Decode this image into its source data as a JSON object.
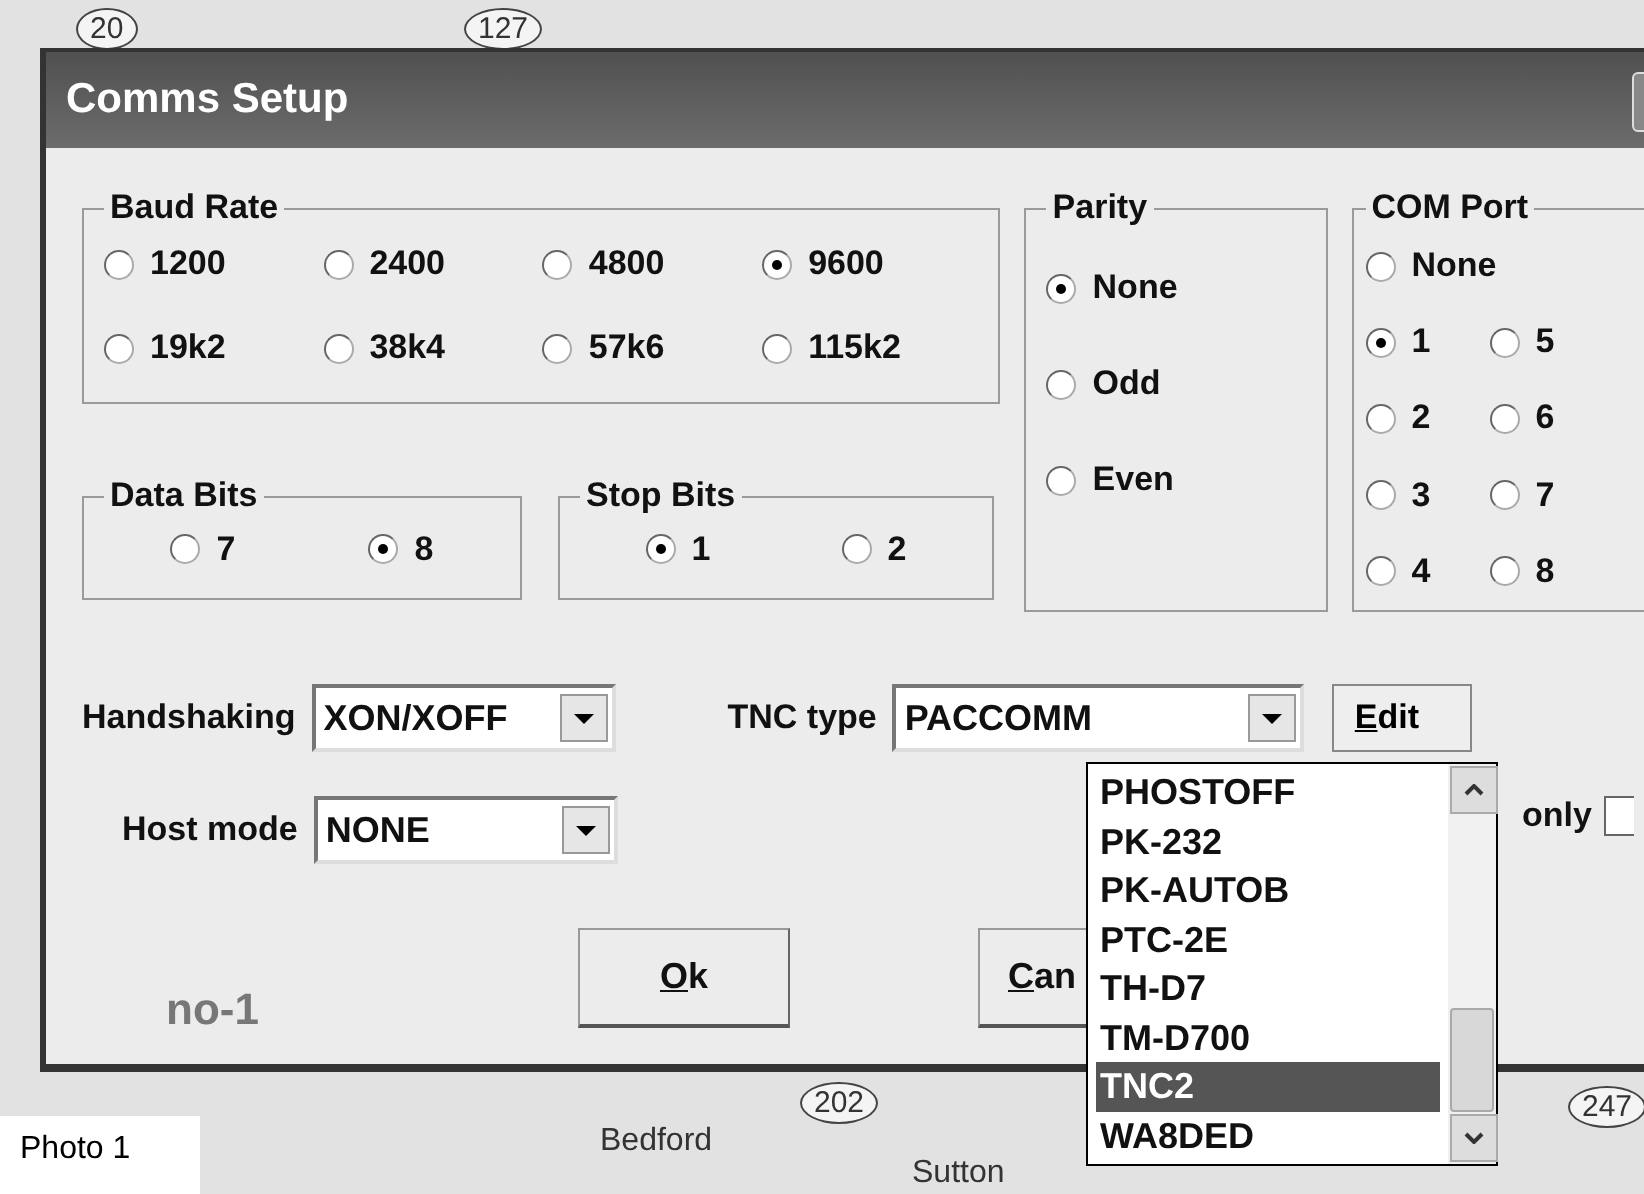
{
  "map": {
    "labels": [
      {
        "text": "20",
        "kind": "route"
      },
      {
        "text": "127",
        "kind": "route"
      },
      {
        "text": "202",
        "kind": "route"
      },
      {
        "text": "247",
        "kind": "route"
      },
      {
        "text": "Bedford",
        "kind": "place"
      },
      {
        "text": "Sutton",
        "kind": "place"
      }
    ]
  },
  "window": {
    "title": "Comms Setup"
  },
  "baud_rate": {
    "label": "Baud Rate",
    "options": [
      {
        "label": "1200",
        "selected": false
      },
      {
        "label": "2400",
        "selected": false
      },
      {
        "label": "4800",
        "selected": false
      },
      {
        "label": "9600",
        "selected": true
      },
      {
        "label": "19k2",
        "selected": false
      },
      {
        "label": "38k4",
        "selected": false
      },
      {
        "label": "57k6",
        "selected": false
      },
      {
        "label": "115k2",
        "selected": false
      }
    ]
  },
  "parity": {
    "label": "Parity",
    "options": [
      {
        "label": "None",
        "selected": true
      },
      {
        "label": "Odd",
        "selected": false
      },
      {
        "label": "Even",
        "selected": false
      }
    ]
  },
  "com_port": {
    "label": "COM Port",
    "options": [
      {
        "label": "None",
        "selected": false
      },
      {
        "label": "1",
        "selected": true
      },
      {
        "label": "5",
        "selected": false
      },
      {
        "label": "2",
        "selected": false
      },
      {
        "label": "6",
        "selected": false
      },
      {
        "label": "3",
        "selected": false
      },
      {
        "label": "7",
        "selected": false
      },
      {
        "label": "4",
        "selected": false
      },
      {
        "label": "8",
        "selected": false
      }
    ]
  },
  "data_bits": {
    "label": "Data Bits",
    "options": [
      {
        "label": "7",
        "selected": false
      },
      {
        "label": "8",
        "selected": true
      }
    ]
  },
  "stop_bits": {
    "label": "Stop Bits",
    "options": [
      {
        "label": "1",
        "selected": true
      },
      {
        "label": "2",
        "selected": false
      }
    ]
  },
  "handshaking": {
    "label": "Handshaking",
    "value": "XON/XOFF"
  },
  "tnc_type": {
    "label": "TNC type",
    "value": "PACCOMM",
    "options": [
      {
        "label": "PHOSTOFF",
        "selected": false
      },
      {
        "label": "PK-232",
        "selected": false
      },
      {
        "label": "PK-AUTOB",
        "selected": false
      },
      {
        "label": "PTC-2E",
        "selected": false
      },
      {
        "label": "TH-D7",
        "selected": false
      },
      {
        "label": "TM-D700",
        "selected": false
      },
      {
        "label": "TNC2",
        "selected": true
      },
      {
        "label": "WA8DED",
        "selected": false
      }
    ]
  },
  "edit_button": {
    "label": "Edit"
  },
  "host_mode": {
    "label": "Host mode",
    "value": "NONE"
  },
  "only_option": {
    "label": "only",
    "checked": false
  },
  "buttons": [
    {
      "label": "Ok"
    },
    {
      "label": "Can"
    }
  ],
  "status_text": "no-1",
  "caption": "Photo 1"
}
